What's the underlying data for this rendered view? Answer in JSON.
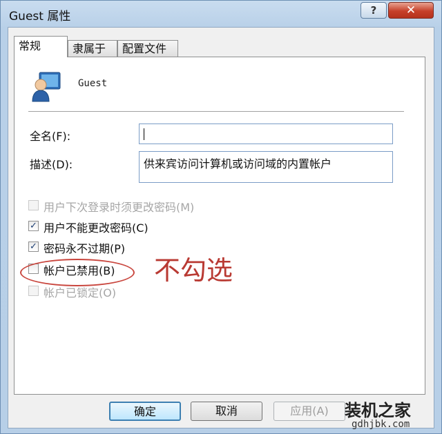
{
  "window": {
    "title": "Guest 属性",
    "help_label": "?",
    "close_label": "✕"
  },
  "tabs": [
    {
      "label": "常规"
    },
    {
      "label": "隶属于"
    },
    {
      "label": "配置文件"
    }
  ],
  "general": {
    "username": "Guest",
    "fullname_label": "全名(F):",
    "fullname_value": "",
    "description_label": "描述(D):",
    "description_value": "供来宾访问计算机或访问域的内置帐户",
    "checkboxes": [
      {
        "label": "用户下次登录时须更改密码(M)",
        "checked": false,
        "enabled": false
      },
      {
        "label": "用户不能更改密码(C)",
        "checked": true,
        "enabled": true
      },
      {
        "label": "密码永不过期(P)",
        "checked": true,
        "enabled": true
      },
      {
        "label": "帐户已禁用(B)",
        "checked": false,
        "enabled": true
      },
      {
        "label": "帐户已锁定(O)",
        "checked": false,
        "enabled": false
      }
    ]
  },
  "annotation": {
    "text": "不勾选",
    "color": "#b93a33"
  },
  "buttons": {
    "ok": "确定",
    "cancel": "取消",
    "apply": "应用(A)"
  },
  "watermark": {
    "logo_text": "装机之家",
    "url": "gdhjbk.com"
  }
}
